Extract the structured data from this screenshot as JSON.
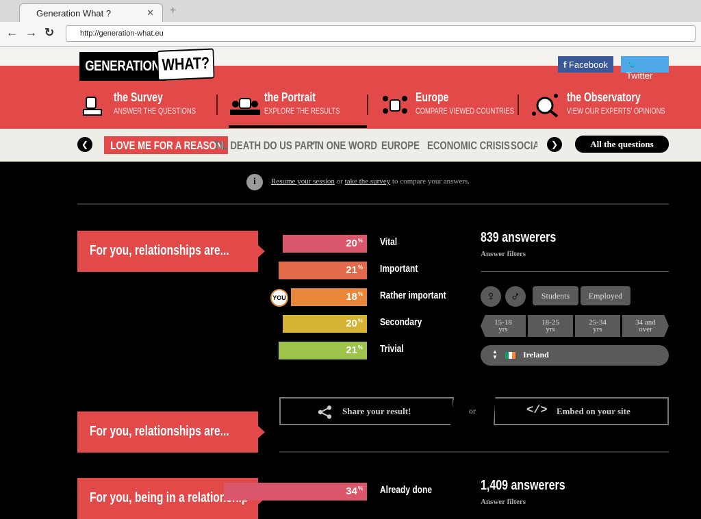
{
  "browser": {
    "tab_title": "Generation What ?",
    "tab_close": "✕",
    "new_tab": "+",
    "back": "←",
    "forward": "→",
    "reload": "↻",
    "url": "http://generation-what.eu"
  },
  "header": {
    "logo_left": "GENERATION",
    "logo_right": "WHAT?",
    "facebook": "Facebook",
    "twitter": "Twitter",
    "brand_color": "#e24a4a"
  },
  "menu": [
    {
      "title": "the Survey",
      "subtitle": "ANSWER THE QUESTIONS"
    },
    {
      "title": "the Portrait",
      "subtitle": "EXPLORE THE RESULTS"
    },
    {
      "title": "Europe",
      "subtitle": "COMPARE VIEWED COUNTRIES"
    },
    {
      "title": "the Observatory",
      "subtitle": "VIEW OUR EXPERTS' OPINIONS"
    }
  ],
  "categories": {
    "prev": "❮",
    "next": "❯",
    "items": [
      "LOVE ME FOR A REASON",
      "TIL DEATH DO US PART",
      "“IN ONE WORD",
      "EUROPE",
      "ECONOMIC CRISIS",
      "SOCIAL"
    ],
    "active": "LOVE ME FOR A REASON",
    "all_questions": "All the questions"
  },
  "notice": {
    "icon": "i",
    "resume_link": "Resume your session",
    "middle": " or ",
    "survey_link": "take the survey",
    "suffix": " to compare your answers."
  },
  "question1": {
    "label": "For you, relationships are...",
    "answerers": "839 answerers",
    "filters_label": "Answer filters",
    "you_badge": "YOU",
    "bars": [
      {
        "label": "Vital",
        "value": 20,
        "color": "#d9566b"
      },
      {
        "label": "Important",
        "value": 21,
        "color": "#e26a4a"
      },
      {
        "label": "Rather important",
        "value": 18,
        "color": "#e8873a"
      },
      {
        "label": "Secondary",
        "value": 20,
        "color": "#d6b234"
      },
      {
        "label": "Trivial",
        "value": 21,
        "color": "#9dc34a"
      }
    ],
    "pct_sign": "%"
  },
  "filters": {
    "female": "♀",
    "male": "♂",
    "students": "Students",
    "employed": "Employed",
    "ages": [
      {
        "top": "15-18",
        "bottom": "yrs"
      },
      {
        "top": "18-25",
        "bottom": "yrs"
      },
      {
        "top": "25-34",
        "bottom": "yrs"
      },
      {
        "top": "34 and",
        "bottom": "over"
      }
    ],
    "country": "Ireland",
    "sort_icon": "▲▼"
  },
  "share": {
    "share_label": "Share your result!",
    "or": "or",
    "embed_label": "Embed on your site"
  },
  "question2": {
    "label": "For you, relationships are..."
  },
  "question3": {
    "label": "For you, being in a relationship",
    "answerers": "1,409 answerers",
    "filters_label": "Answer filters",
    "bars": [
      {
        "label": "Already done",
        "value": 34,
        "color": "#d9566b"
      }
    ],
    "pct_sign": "%"
  }
}
